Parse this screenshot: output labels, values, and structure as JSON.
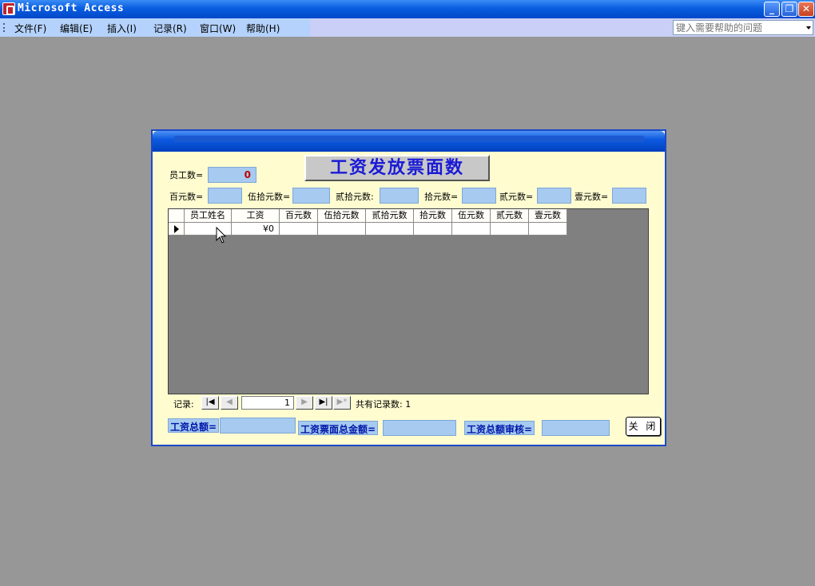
{
  "window": {
    "title": "Microsoft Access",
    "controls": [
      "_",
      "❐",
      "✕"
    ]
  },
  "menubar": {
    "items": [
      "文件(F)",
      "编辑(E)",
      "插入(I)",
      "记录(R)",
      "窗口(W)",
      "帮助(H)"
    ],
    "help_placeholder": "键入需要帮助的问题"
  },
  "form": {
    "title_button": "工资发放票面数",
    "employee_count_label": "员工数=",
    "employee_count_value": "0",
    "denominations": [
      {
        "label": "百元数="
      },
      {
        "label": "伍拾元数="
      },
      {
        "label": "贰拾元数:"
      },
      {
        "label": "拾元数="
      },
      {
        "label": "贰元数="
      },
      {
        "label": "壹元数="
      }
    ],
    "grid": {
      "columns": [
        "员工姓名",
        "工资",
        "百元数",
        "伍拾元数",
        "贰拾元数",
        "拾元数",
        "伍元数",
        "贰元数",
        "壹元数"
      ],
      "rows": [
        [
          "",
          "¥0",
          "",
          "",
          "",
          "",
          "",
          "",
          ""
        ]
      ]
    },
    "navigator": {
      "record_label": "记录:",
      "current": "1",
      "total_label": "共有记录数: 1",
      "buttons": [
        "first",
        "prev",
        "next",
        "last",
        "new"
      ]
    },
    "totals": {
      "salary_total_label": "工资总额=",
      "ticket_total_label": "工资票面总金额=",
      "audit_label": "工资总额审核="
    },
    "close_button": "关 闭"
  }
}
